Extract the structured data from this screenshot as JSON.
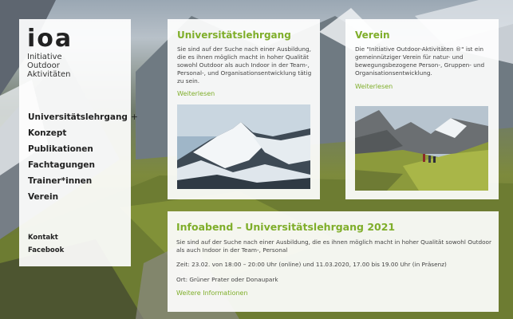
{
  "logo": {
    "mark": "ioa",
    "lines": [
      "Initiative",
      "Outdoor",
      "Aktivitäten"
    ]
  },
  "nav": {
    "items": [
      {
        "label": "Universitätslehrgang",
        "suffix": "+"
      },
      {
        "label": "Konzept"
      },
      {
        "label": "Publikationen"
      },
      {
        "label": "Fachtagungen"
      },
      {
        "label": "Trainer*innen"
      },
      {
        "label": "Verein"
      }
    ],
    "secondary": [
      {
        "label": "Kontakt"
      },
      {
        "label": "Facebook"
      }
    ]
  },
  "cards": {
    "universitaetslehrgang": {
      "title": "Universitätslehrgang",
      "body": "Sie sind auf der Suche nach einer Ausbildung, die es ihnen möglich macht in hoher Qualität sowohl Outdoor als auch Indoor in der Team-, Personal-, und Organisationsentwicklung tätig zu sein.",
      "link": "Weiterlesen",
      "image": "snowy-mountain-peak"
    },
    "verein": {
      "title": "Verein",
      "body": "Die \"Initiative Outdoor-Aktivitäten ®\" ist ein gemeinnütziger Verein für natur- und bewegungsbezogene Person-, Gruppen- und Organisationsentwicklung.",
      "link": "Weiterlesen",
      "image": "hikers-in-alpine-valley"
    },
    "infoabend": {
      "title": "Infoabend – Universitätslehrgang 2021",
      "body": "Sie sind auf der Suche nach einer Ausbildung, die es ihnen möglich macht in hoher Qualität sowohl Outdoor als auch Indoor in der Team-, Personal",
      "time": "Zeit: 23.02. von 18:00 – 20:00 Uhr (online) und 11.03.2020, 17.00 bis 19.00 Uhr (in Präsenz)",
      "place": "Ort: Grüner Prater oder Donaupark",
      "link": "Weitere Informationen"
    }
  },
  "colors": {
    "accent": "#7fae2a",
    "panel": "#ffffff",
    "text": "#444444"
  }
}
